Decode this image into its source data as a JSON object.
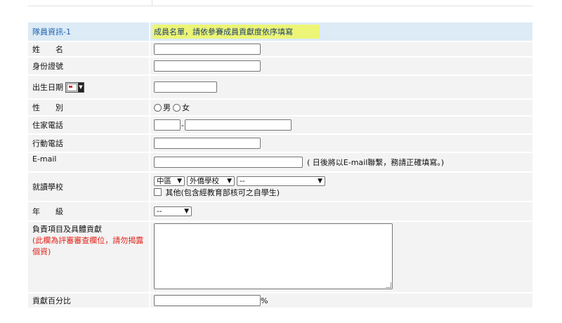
{
  "header": {
    "section": "隊員資訊-1",
    "instruction": "成員名單，請依參賽成員貢獻度依序填寫"
  },
  "fields": {
    "name": {
      "label": "姓　　名"
    },
    "id_number": {
      "label": "身份證號"
    },
    "birth_date": {
      "label": "出生日期",
      "picker_icon": "calendar-icon"
    },
    "gender": {
      "label": "性　　別",
      "options": [
        "男",
        "女"
      ]
    },
    "home_phone": {
      "label": "住家電話",
      "separator": "-"
    },
    "mobile": {
      "label": "行動電話"
    },
    "email": {
      "label": "E-mail",
      "note": "( 日後將以E-mail聯繫，務請正確填寫。)"
    },
    "school": {
      "label": "就讀學校",
      "region_value": "中區",
      "type_value": "外僑學校",
      "school_value": "--",
      "other_label": "其他(包含經教育部核可之自學生)"
    },
    "grade": {
      "label": "年　　級",
      "value": "--"
    },
    "contribution": {
      "label": "負責項目及具體貢獻",
      "warning": "(此欄為評審審查欄位，請勿揭露個資)"
    },
    "percent": {
      "label": "貢獻百分比",
      "unit": "%"
    }
  },
  "colors": {
    "header_bg": "#dcebf6",
    "row_bg": "#f3f3f3",
    "highlight": "#ecf575",
    "warning": "#e0241b",
    "section_title": "#1d5fae"
  }
}
